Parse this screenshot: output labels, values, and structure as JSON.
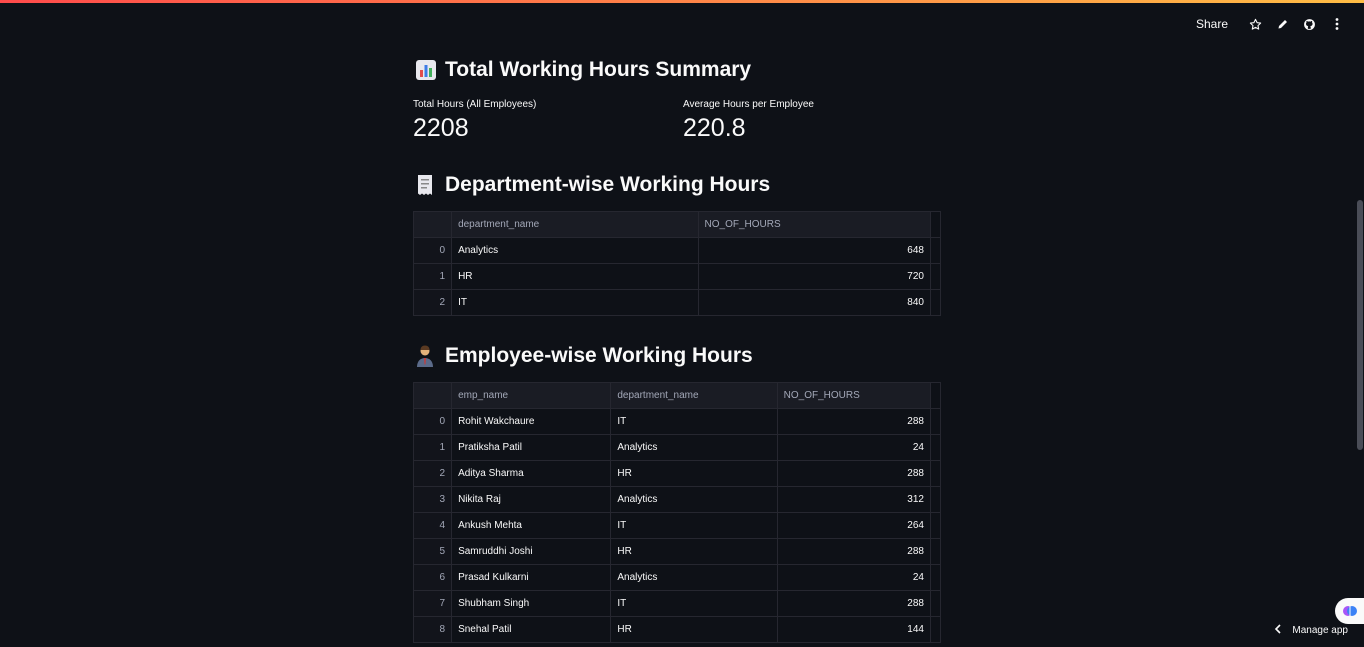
{
  "toolbar": {
    "share_label": "Share",
    "icons": [
      "star-icon",
      "pencil-icon",
      "github-icon",
      "more-vertical-icon"
    ]
  },
  "summary": {
    "title": "Total Working Hours Summary",
    "emoji": "bar-chart-emoji",
    "metrics": [
      {
        "label": "Total Hours (All Employees)",
        "value": "2208"
      },
      {
        "label": "Average Hours per Employee",
        "value": "220.8"
      }
    ]
  },
  "department": {
    "title": "Department-wise Working Hours",
    "emoji": "receipt-emoji",
    "columns": [
      "department_name",
      "NO_OF_HOURS"
    ],
    "rows": [
      {
        "idx": "0",
        "department_name": "Analytics",
        "hours": "648"
      },
      {
        "idx": "1",
        "department_name": "HR",
        "hours": "720"
      },
      {
        "idx": "2",
        "department_name": "IT",
        "hours": "840"
      }
    ]
  },
  "employee": {
    "title": "Employee-wise Working Hours",
    "emoji": "office-worker-emoji",
    "columns": [
      "emp_name",
      "department_name",
      "NO_OF_HOURS"
    ],
    "rows": [
      {
        "idx": "0",
        "emp_name": "Rohit Wakchaure",
        "department_name": "IT",
        "hours": "288"
      },
      {
        "idx": "1",
        "emp_name": "Pratiksha Patil",
        "department_name": "Analytics",
        "hours": "24"
      },
      {
        "idx": "2",
        "emp_name": "Aditya Sharma",
        "department_name": "HR",
        "hours": "288"
      },
      {
        "idx": "3",
        "emp_name": "Nikita Raj",
        "department_name": "Analytics",
        "hours": "312"
      },
      {
        "idx": "4",
        "emp_name": "Ankush Mehta",
        "department_name": "IT",
        "hours": "264"
      },
      {
        "idx": "5",
        "emp_name": "Samruddhi Joshi",
        "department_name": "HR",
        "hours": "288"
      },
      {
        "idx": "6",
        "emp_name": "Prasad Kulkarni",
        "department_name": "Analytics",
        "hours": "24"
      },
      {
        "idx": "7",
        "emp_name": "Shubham Singh",
        "department_name": "IT",
        "hours": "288"
      },
      {
        "idx": "8",
        "emp_name": "Snehal Patil",
        "department_name": "HR",
        "hours": "144"
      }
    ]
  },
  "footer": {
    "manage_label": "Manage app"
  },
  "colors": {
    "background": "#0e1117",
    "accent_gradient_start": "#ff4b4b",
    "accent_gradient_end": "#ffbd45"
  }
}
